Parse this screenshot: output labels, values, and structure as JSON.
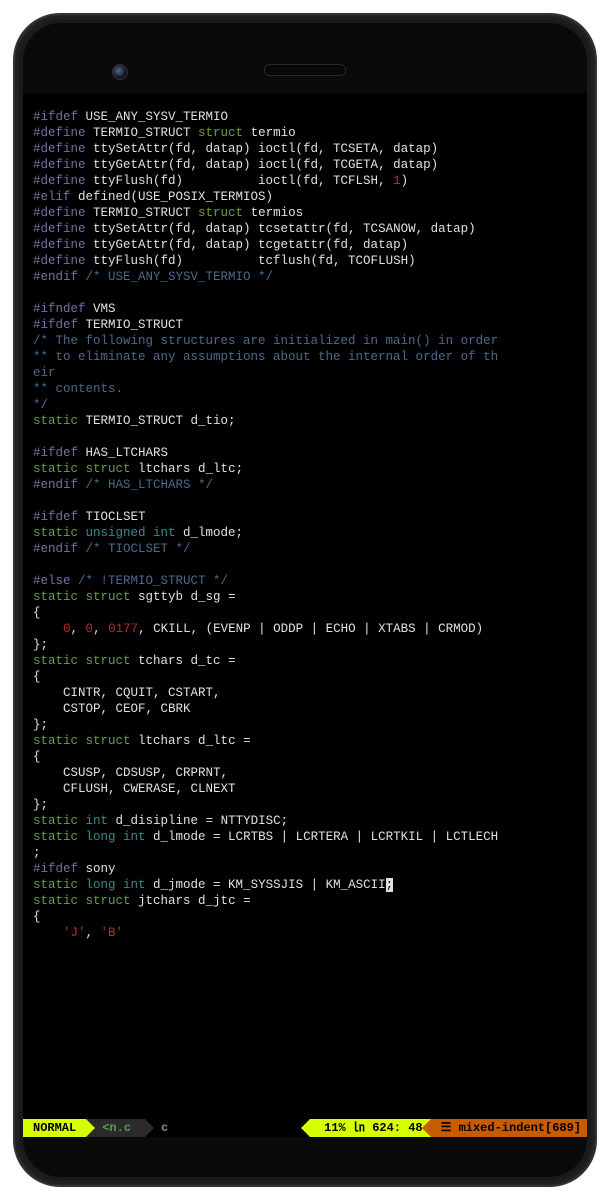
{
  "code": {
    "lines": [
      [
        [
          "pp",
          "#ifdef"
        ],
        [
          "id",
          " USE_ANY_SYSV_TERMIO"
        ]
      ],
      [
        [
          "pp",
          "#define"
        ],
        [
          "id",
          " TERMIO_STRUCT "
        ],
        [
          "kw",
          "struct"
        ],
        [
          "id",
          " termio"
        ]
      ],
      [
        [
          "pp",
          "#define"
        ],
        [
          "id",
          " ttySetAttr(fd, datap) ioctl(fd, TCSETA, datap)"
        ]
      ],
      [
        [
          "pp",
          "#define"
        ],
        [
          "id",
          " ttyGetAttr(fd, datap) ioctl(fd, TCGETA, datap)"
        ]
      ],
      [
        [
          "pp",
          "#define"
        ],
        [
          "id",
          " ttyFlush(fd)          ioctl(fd, TCFLSH, "
        ],
        [
          "num",
          "1"
        ],
        [
          "id",
          ")"
        ]
      ],
      [
        [
          "pp",
          "#elif"
        ],
        [
          "id",
          " defined(USE_POSIX_TERMIOS)"
        ]
      ],
      [
        [
          "pp",
          "#define"
        ],
        [
          "id",
          " TERMIO_STRUCT "
        ],
        [
          "kw",
          "struct"
        ],
        [
          "id",
          " termios"
        ]
      ],
      [
        [
          "pp",
          "#define"
        ],
        [
          "id",
          " ttySetAttr(fd, datap) tcsetattr(fd, TCSANOW, datap)"
        ]
      ],
      [
        [
          "pp",
          "#define"
        ],
        [
          "id",
          " ttyGetAttr(fd, datap) tcgetattr(fd, datap)"
        ]
      ],
      [
        [
          "pp",
          "#define"
        ],
        [
          "id",
          " ttyFlush(fd)          tcflush(fd, TCOFLUSH)"
        ]
      ],
      [
        [
          "pp",
          "#endif"
        ],
        [
          "cm",
          " /* USE_ANY_SYSV_TERMIO */"
        ]
      ],
      [
        [
          "id",
          ""
        ]
      ],
      [
        [
          "pp",
          "#ifndef"
        ],
        [
          "id",
          " VMS"
        ]
      ],
      [
        [
          "pp",
          "#ifdef"
        ],
        [
          "id",
          " TERMIO_STRUCT"
        ]
      ],
      [
        [
          "cm",
          "/* The following structures are initialized in main() in order"
        ]
      ],
      [
        [
          "cm",
          "** to eliminate any assumptions about the internal order of th"
        ]
      ],
      [
        [
          "cm",
          "eir"
        ]
      ],
      [
        [
          "cm",
          "** contents."
        ]
      ],
      [
        [
          "cm",
          "*/"
        ]
      ],
      [
        [
          "kw",
          "static"
        ],
        [
          "id",
          " TERMIO_STRUCT d_tio;"
        ]
      ],
      [
        [
          "id",
          ""
        ]
      ],
      [
        [
          "pp",
          "#ifdef"
        ],
        [
          "id",
          " HAS_LTCHARS"
        ]
      ],
      [
        [
          "kw",
          "static"
        ],
        [
          "id",
          " "
        ],
        [
          "kw",
          "struct"
        ],
        [
          "id",
          " ltchars d_ltc;"
        ]
      ],
      [
        [
          "pp",
          "#endif"
        ],
        [
          "cm",
          " /* HAS_LTCHARS */"
        ]
      ],
      [
        [
          "id",
          ""
        ]
      ],
      [
        [
          "pp",
          "#ifdef"
        ],
        [
          "id",
          " TIOCLSET"
        ]
      ],
      [
        [
          "kw",
          "static"
        ],
        [
          "id",
          " "
        ],
        [
          "ty",
          "unsigned int"
        ],
        [
          "id",
          " d_lmode;"
        ]
      ],
      [
        [
          "pp",
          "#endif"
        ],
        [
          "cm",
          " /* TIOCLSET */"
        ]
      ],
      [
        [
          "id",
          ""
        ]
      ],
      [
        [
          "pp",
          "#else"
        ],
        [
          "cm",
          " /* !TERMIO_STRUCT */"
        ]
      ],
      [
        [
          "kw",
          "static"
        ],
        [
          "id",
          " "
        ],
        [
          "kw",
          "struct"
        ],
        [
          "id",
          " sgttyb d_sg ="
        ]
      ],
      [
        [
          "id",
          "{"
        ]
      ],
      [
        [
          "id",
          "    "
        ],
        [
          "num",
          "0"
        ],
        [
          "id",
          ", "
        ],
        [
          "num",
          "0"
        ],
        [
          "id",
          ", "
        ],
        [
          "num",
          "0177"
        ],
        [
          "id",
          ", CKILL, (EVENP | ODDP | ECHO | XTABS | CRMOD)"
        ]
      ],
      [
        [
          "id",
          "};"
        ]
      ],
      [
        [
          "kw",
          "static"
        ],
        [
          "id",
          " "
        ],
        [
          "kw",
          "struct"
        ],
        [
          "id",
          " tchars d_tc ="
        ]
      ],
      [
        [
          "id",
          "{"
        ]
      ],
      [
        [
          "id",
          "    CINTR, CQUIT, CSTART,"
        ]
      ],
      [
        [
          "id",
          "    CSTOP, CEOF, CBRK"
        ]
      ],
      [
        [
          "id",
          "};"
        ]
      ],
      [
        [
          "kw",
          "static"
        ],
        [
          "id",
          " "
        ],
        [
          "kw",
          "struct"
        ],
        [
          "id",
          " ltchars d_ltc ="
        ]
      ],
      [
        [
          "id",
          "{"
        ]
      ],
      [
        [
          "id",
          "    CSUSP, CDSUSP, CRPRNT,"
        ]
      ],
      [
        [
          "id",
          "    CFLUSH, CWERASE, CLNEXT"
        ]
      ],
      [
        [
          "id",
          "};"
        ]
      ],
      [
        [
          "kw",
          "static"
        ],
        [
          "id",
          " "
        ],
        [
          "ty",
          "int"
        ],
        [
          "id",
          " d_disipline = NTTYDISC;"
        ]
      ],
      [
        [
          "kw",
          "static"
        ],
        [
          "id",
          " "
        ],
        [
          "ty",
          "long int"
        ],
        [
          "id",
          " d_lmode = LCRTBS | LCRTERA | LCRTKIL | LCTLECH"
        ]
      ],
      [
        [
          "id",
          ";"
        ]
      ],
      [
        [
          "pp",
          "#ifdef"
        ],
        [
          "id",
          " sony"
        ]
      ],
      [
        [
          "kw",
          "static"
        ],
        [
          "id",
          " "
        ],
        [
          "ty",
          "long int"
        ],
        [
          "id",
          " d_jmode = KM_SYSSJIS | KM_ASCII"
        ],
        [
          "caret",
          ";"
        ]
      ],
      [
        [
          "kw",
          "static"
        ],
        [
          "id",
          " "
        ],
        [
          "kw",
          "struct"
        ],
        [
          "id",
          " jtchars d_jtc ="
        ]
      ],
      [
        [
          "id",
          "{"
        ]
      ],
      [
        [
          "id",
          "    "
        ],
        [
          "num",
          "'J'"
        ],
        [
          "id",
          ", "
        ],
        [
          "num",
          "'B'"
        ]
      ]
    ]
  },
  "statusbar": {
    "mode": "NORMAL",
    "file": "<n.c",
    "type": "c",
    "percent": "11%",
    "lnicon": "㏑",
    "line": "624",
    "col": "48",
    "warn_icon": "☰",
    "warn": "mixed-indent[689]"
  }
}
